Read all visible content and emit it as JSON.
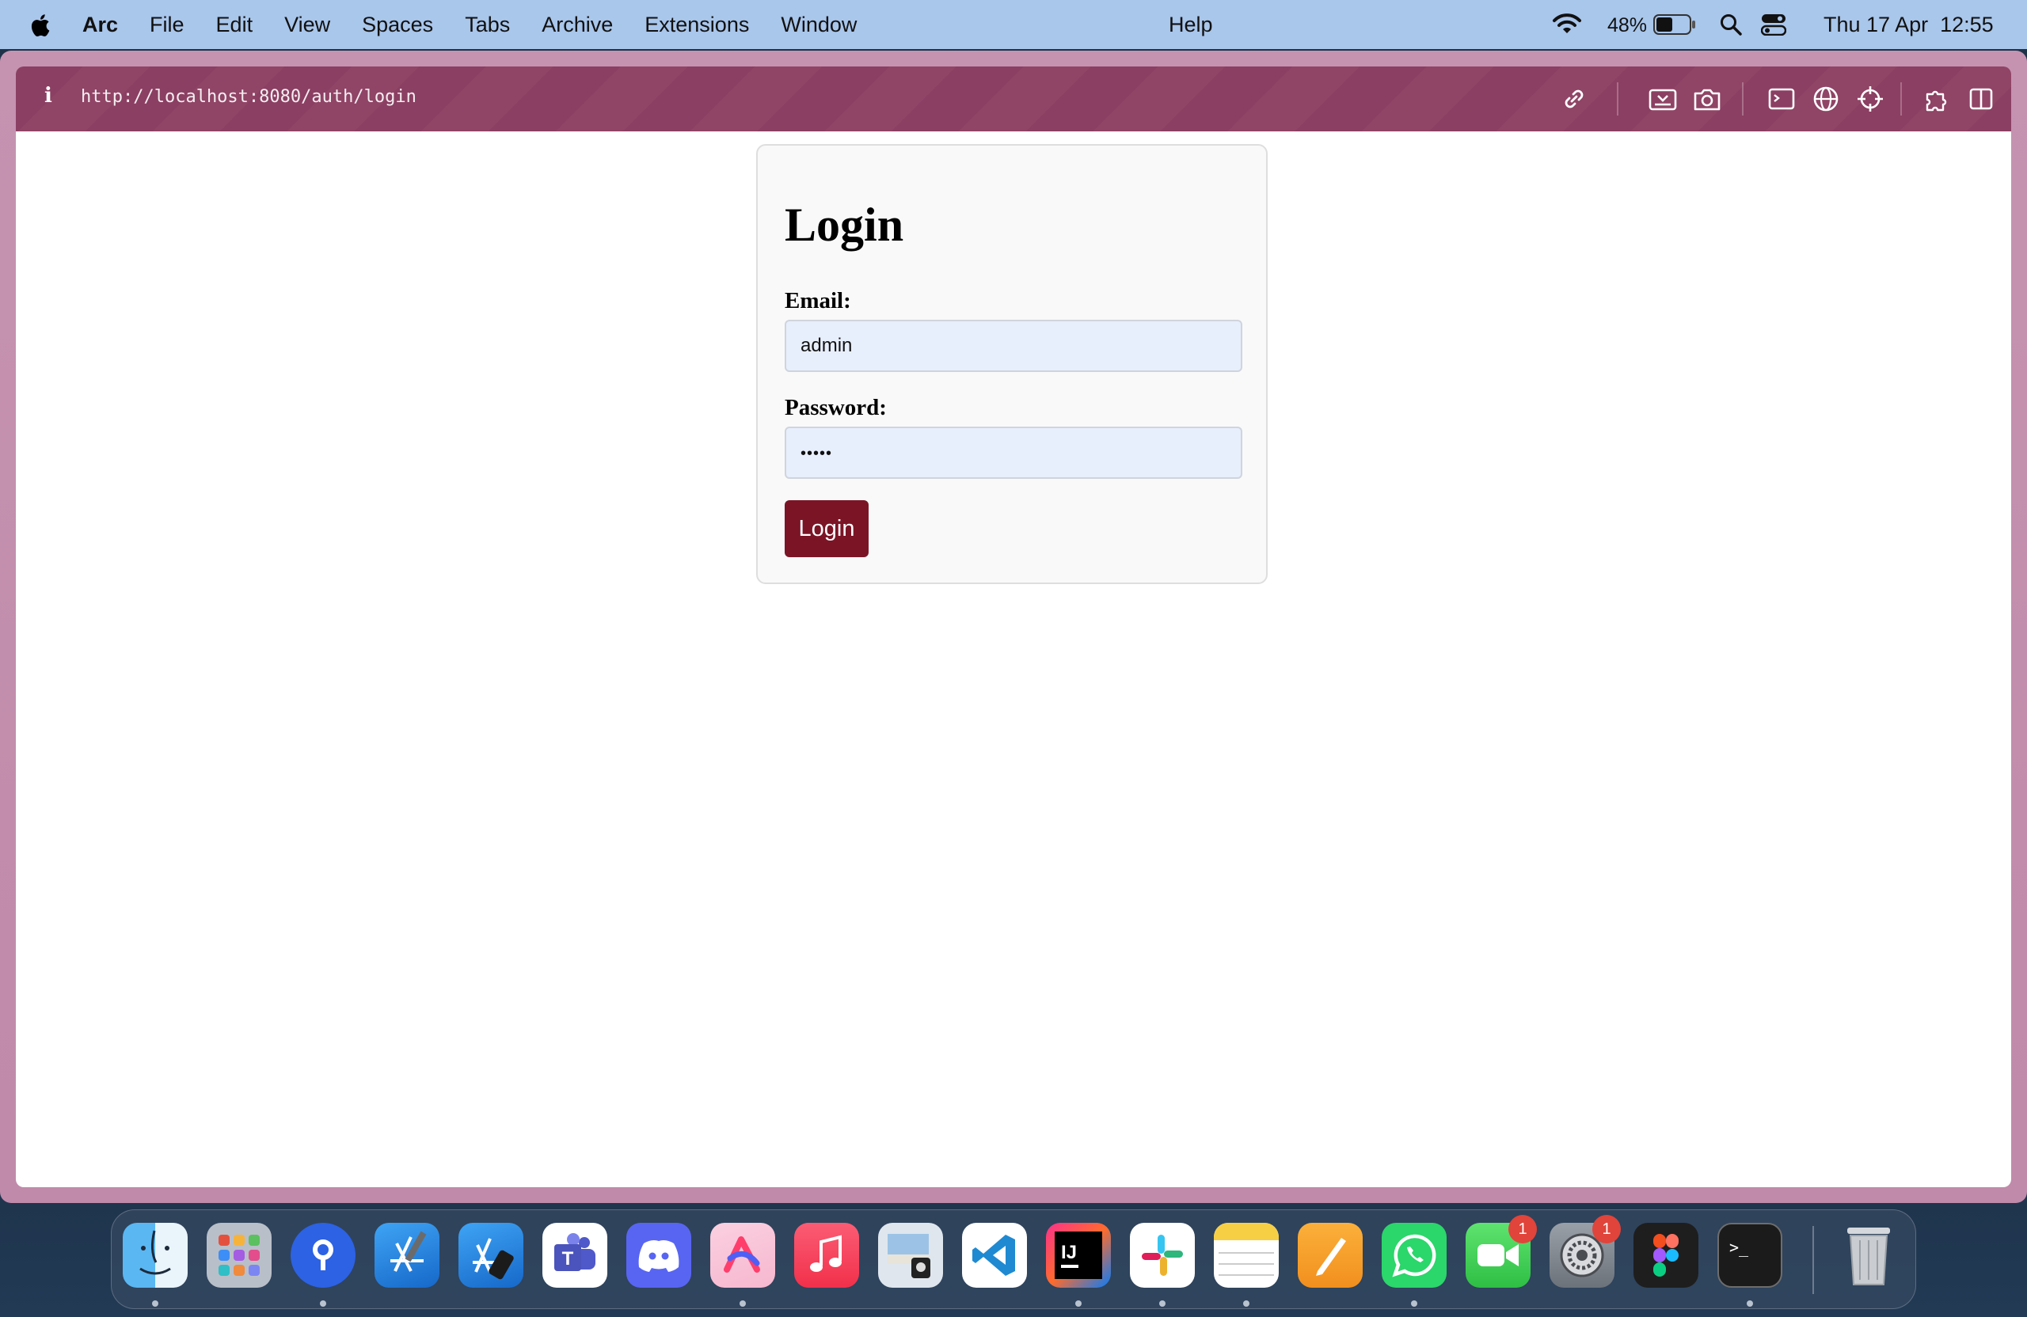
{
  "menubar": {
    "app_name": "Arc",
    "items": [
      "File",
      "Edit",
      "View",
      "Spaces",
      "Tabs",
      "Archive",
      "Extensions",
      "Window"
    ],
    "help": "Help",
    "battery_percent": "48%",
    "datetime": "Thu 17 Apr  12:55",
    "icons": [
      "apple-icon",
      "wifi-icon",
      "battery-icon",
      "spotlight-search-icon",
      "control-center-icon"
    ]
  },
  "browser": {
    "info_glyph": "i",
    "url": "http://localhost:8080/auth/login",
    "toolbar_icons": [
      "link-icon",
      "capture-icon",
      "camera-icon",
      "console-icon",
      "globe-icon",
      "crosshair-icon",
      "extensions-icon",
      "split-view-icon"
    ],
    "theme_color": "#8b3f62"
  },
  "login": {
    "title": "Login",
    "email_label": "Email:",
    "email_value": "admin",
    "password_label": "Password:",
    "password_masked": "•••••",
    "button_label": "Login",
    "button_color": "#7b1526"
  },
  "dock": {
    "apps": [
      {
        "name": "Finder",
        "icon": "finder-icon",
        "running": true
      },
      {
        "name": "Launchpad",
        "icon": "launchpad-icon",
        "running": false
      },
      {
        "name": "Proton Pass",
        "icon": "pass-icon",
        "running": true
      },
      {
        "name": "Xcode",
        "icon": "xcode-icon",
        "running": false
      },
      {
        "name": "Simulator",
        "icon": "simulator-icon",
        "running": false
      },
      {
        "name": "Microsoft Teams",
        "icon": "teams-icon",
        "running": false
      },
      {
        "name": "Discord",
        "icon": "discord-icon",
        "running": false
      },
      {
        "name": "Arc",
        "icon": "arc-icon",
        "running": true
      },
      {
        "name": "Music",
        "icon": "music-icon",
        "running": false
      },
      {
        "name": "Preview",
        "icon": "preview-icon",
        "running": false
      },
      {
        "name": "Visual Studio Code",
        "icon": "vscode-icon",
        "running": false
      },
      {
        "name": "IntelliJ IDEA",
        "icon": "intellij-icon",
        "running": true
      },
      {
        "name": "Slack",
        "icon": "slack-icon",
        "running": true
      },
      {
        "name": "Notes",
        "icon": "notes-icon",
        "running": true
      },
      {
        "name": "Pages",
        "icon": "pages-icon",
        "running": false
      },
      {
        "name": "WhatsApp",
        "icon": "whatsapp-icon",
        "running": true
      },
      {
        "name": "FaceTime",
        "icon": "facetime-icon",
        "running": false,
        "badge": "1"
      },
      {
        "name": "System Settings",
        "icon": "settings-icon",
        "running": false,
        "badge": "1"
      },
      {
        "name": "Figma",
        "icon": "figma-icon",
        "running": false
      },
      {
        "name": "Terminal",
        "icon": "terminal-icon",
        "running": true
      },
      {
        "name": "Trash",
        "icon": "trash-icon",
        "running": false
      }
    ]
  }
}
